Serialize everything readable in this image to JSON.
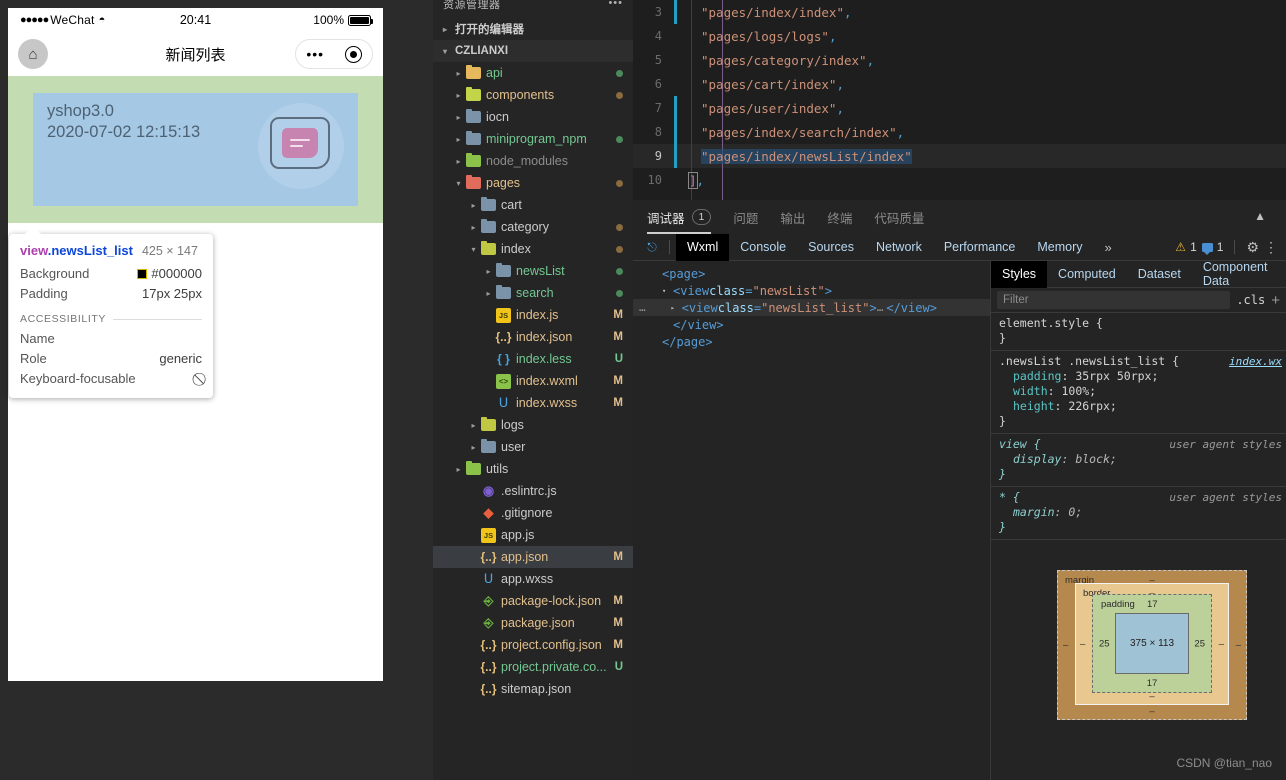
{
  "simulator": {
    "status_bar": {
      "carrier": "WeChat",
      "dots": "●●●●●",
      "wifi_icon": "wifi-icon",
      "time": "20:41",
      "battery_pct": "100%"
    },
    "nav_bar": {
      "home_icon": "home-icon",
      "title": "新闻列表",
      "menu_dots": "•••",
      "target_icon": "target-icon"
    },
    "news_item": {
      "title": "yshop3.0",
      "date": "2020-07-02 12:15:13",
      "thumb_icon": "news-thumbnail-icon"
    }
  },
  "inspect_tooltip": {
    "tag": "view",
    "class": ".newsList_list",
    "dimensions": "425 × 147",
    "rows": [
      {
        "label": "Background",
        "value": "#000000",
        "swatch": "#000000"
      },
      {
        "label": "Padding",
        "value": "17px 25px"
      }
    ],
    "a11y_header": "ACCESSIBILITY",
    "a11y_rows": [
      {
        "label": "Name",
        "value": ""
      },
      {
        "label": "Role",
        "value": "generic"
      },
      {
        "label": "Keyboard-focusable",
        "value": "⃠"
      }
    ]
  },
  "explorer": {
    "header_title": "资源管理器",
    "header_more": "•••",
    "open_editors": "打开的编辑器",
    "project_name": "CZLIANXI",
    "items": [
      {
        "name": "api",
        "type": "folder",
        "icon": "folder-yellow-icon",
        "indent": 1,
        "arrow": "▸",
        "color": "c-green",
        "dot": "d-green",
        "status": ""
      },
      {
        "name": "components",
        "type": "folder",
        "icon": "folder-ylgreen-icon",
        "indent": 1,
        "arrow": "▸",
        "color": "c-orange",
        "dot": "d-orange",
        "status": ""
      },
      {
        "name": "iocn",
        "type": "folder",
        "icon": "folder-blue-icon",
        "indent": 1,
        "arrow": "▸",
        "color": "c-white",
        "dot": "",
        "status": ""
      },
      {
        "name": "miniprogram_npm",
        "type": "folder",
        "icon": "folder-blue-icon",
        "indent": 1,
        "arrow": "▸",
        "color": "c-green",
        "dot": "d-green",
        "status": ""
      },
      {
        "name": "node_modules",
        "type": "folder",
        "icon": "folder-green-icon",
        "indent": 1,
        "arrow": "▸",
        "color": "c-gray",
        "dot": "",
        "status": ""
      },
      {
        "name": "pages",
        "type": "folder",
        "icon": "folder-red-icon",
        "indent": 1,
        "arrow": "▾",
        "color": "c-orange",
        "dot": "d-orange",
        "status": ""
      },
      {
        "name": "cart",
        "type": "folder",
        "icon": "folder-blue-icon",
        "indent": 2,
        "arrow": "▸",
        "color": "c-white",
        "dot": "",
        "status": ""
      },
      {
        "name": "category",
        "type": "folder",
        "icon": "folder-blue-icon",
        "indent": 2,
        "arrow": "▸",
        "color": "c-white",
        "dot": "d-orange",
        "status": ""
      },
      {
        "name": "index",
        "type": "folder",
        "icon": "folder-olive-icon",
        "indent": 2,
        "arrow": "▾",
        "color": "c-white",
        "dot": "d-orange",
        "status": ""
      },
      {
        "name": "newsList",
        "type": "folder",
        "icon": "folder-blue-icon",
        "indent": 3,
        "arrow": "▸",
        "color": "c-green",
        "dot": "d-green",
        "status": ""
      },
      {
        "name": "search",
        "type": "folder",
        "icon": "folder-blue-icon",
        "indent": 3,
        "arrow": "▸",
        "color": "c-green",
        "dot": "d-green",
        "status": ""
      },
      {
        "name": "index.js",
        "type": "file",
        "icon": "js-file-icon",
        "indent": 3,
        "arrow": "",
        "color": "c-orange",
        "dot": "",
        "status": "M"
      },
      {
        "name": "index.json",
        "type": "file",
        "icon": "json-file-icon",
        "indent": 3,
        "arrow": "",
        "color": "c-orange",
        "dot": "",
        "status": "M"
      },
      {
        "name": "index.less",
        "type": "file",
        "icon": "less-file-icon",
        "indent": 3,
        "arrow": "",
        "color": "c-green",
        "dot": "",
        "status": "U"
      },
      {
        "name": "index.wxml",
        "type": "file",
        "icon": "wxml-file-icon",
        "indent": 3,
        "arrow": "",
        "color": "c-orange",
        "dot": "",
        "status": "M"
      },
      {
        "name": "index.wxss",
        "type": "file",
        "icon": "wxss-file-icon",
        "indent": 3,
        "arrow": "",
        "color": "c-orange",
        "dot": "",
        "status": "M"
      },
      {
        "name": "logs",
        "type": "folder",
        "icon": "folder-olive-icon",
        "indent": 2,
        "arrow": "▸",
        "color": "c-white",
        "dot": "",
        "status": ""
      },
      {
        "name": "user",
        "type": "folder",
        "icon": "folder-blue-icon",
        "indent": 2,
        "arrow": "▸",
        "color": "c-white",
        "dot": "",
        "status": ""
      },
      {
        "name": "utils",
        "type": "folder",
        "icon": "folder-green-icon",
        "indent": 1,
        "arrow": "▸",
        "color": "c-white",
        "dot": "",
        "status": ""
      },
      {
        "name": ".eslintrc.js",
        "type": "file",
        "icon": "eslint-file-icon",
        "indent": 2,
        "arrow": "",
        "color": "c-white",
        "dot": "",
        "status": ""
      },
      {
        "name": ".gitignore",
        "type": "file",
        "icon": "git-file-icon",
        "indent": 2,
        "arrow": "",
        "color": "c-white",
        "dot": "",
        "status": ""
      },
      {
        "name": "app.js",
        "type": "file",
        "icon": "js-file-icon",
        "indent": 2,
        "arrow": "",
        "color": "c-white",
        "dot": "",
        "status": ""
      },
      {
        "name": "app.json",
        "type": "file",
        "icon": "json-file-icon",
        "indent": 2,
        "arrow": "",
        "color": "c-orange",
        "dot": "",
        "status": "M",
        "selected": true
      },
      {
        "name": "app.wxss",
        "type": "file",
        "icon": "wxss-file-icon",
        "indent": 2,
        "arrow": "",
        "color": "c-white",
        "dot": "",
        "status": ""
      },
      {
        "name": "package-lock.json",
        "type": "file",
        "icon": "npm-file-icon",
        "indent": 2,
        "arrow": "",
        "color": "c-orange",
        "dot": "",
        "status": "M"
      },
      {
        "name": "package.json",
        "type": "file",
        "icon": "npm-file-icon",
        "indent": 2,
        "arrow": "",
        "color": "c-orange",
        "dot": "",
        "status": "M"
      },
      {
        "name": "project.config.json",
        "type": "file",
        "icon": "json-file-icon",
        "indent": 2,
        "arrow": "",
        "color": "c-orange",
        "dot": "",
        "status": "M"
      },
      {
        "name": "project.private.co...",
        "type": "file",
        "icon": "json-file-icon",
        "indent": 2,
        "arrow": "",
        "color": "c-green",
        "dot": "",
        "status": "U"
      },
      {
        "name": "sitemap.json",
        "type": "file",
        "icon": "json-file-icon",
        "indent": 2,
        "arrow": "",
        "color": "c-white",
        "dot": "",
        "status": ""
      }
    ]
  },
  "editor": {
    "lines": [
      {
        "num": "3",
        "text": "\"pages/index/index\",",
        "git": true,
        "active": false
      },
      {
        "num": "4",
        "text": "\"pages/logs/logs\",",
        "git": false,
        "active": false
      },
      {
        "num": "5",
        "text": "\"pages/category/index\",",
        "git": false,
        "active": false
      },
      {
        "num": "6",
        "text": "\"pages/cart/index\",",
        "git": false,
        "active": false
      },
      {
        "num": "7",
        "text": "\"pages/user/index\",",
        "git": true,
        "active": false
      },
      {
        "num": "8",
        "text": "\"pages/index/search/index\",",
        "git": true,
        "active": false
      },
      {
        "num": "9",
        "text": "\"pages/index/newsList/index\"",
        "git": true,
        "active": true
      },
      {
        "num": "10",
        "text": "],",
        "git": false,
        "active": false
      }
    ]
  },
  "devtools": {
    "tabs": [
      {
        "label": "调试器",
        "badge": "1",
        "active": true
      },
      {
        "label": "问题",
        "badge": "",
        "active": false
      },
      {
        "label": "输出",
        "badge": "",
        "active": false
      },
      {
        "label": "终端",
        "badge": "",
        "active": false
      },
      {
        "label": "代码质量",
        "badge": "",
        "active": false
      }
    ],
    "collapse_icon": "chevron-up-icon",
    "panel_tabs": [
      {
        "label": "Wxml",
        "active": true
      },
      {
        "label": "Console",
        "active": false
      },
      {
        "label": "Sources",
        "active": false
      },
      {
        "label": "Network",
        "active": false
      },
      {
        "label": "Performance",
        "active": false
      },
      {
        "label": "Memory",
        "active": false
      }
    ],
    "more_tabs_icon": "»",
    "warning_count": "1",
    "message_count": "1",
    "gear_icon": "gear-icon",
    "kebab_icon": "kebab-menu-icon",
    "wxml_tree": [
      {
        "indent": 0,
        "tri": "",
        "html": "<span class=\"tagc\">&lt;page&gt;</span>",
        "sel": false,
        "ellipsis": false
      },
      {
        "indent": 1,
        "tri": "▾",
        "html": "<span class=\"tagc\">&lt;view </span><span class=\"attr-n\">class</span><span class=\"tagc\">=</span><span class=\"attr-v\">\"newsList\"</span><span class=\"tagc\">&gt;</span>",
        "sel": false,
        "ellipsis": false
      },
      {
        "indent": 2,
        "tri": "▸",
        "html": "<span class=\"tagc\">&lt;view </span><span class=\"attr-n\">class</span><span class=\"tagc\">=</span><span class=\"attr-v\">\"newsList_list\"</span><span class=\"tagc\">&gt;</span><span class=\"ellip\">…</span><span class=\"tagc\">&lt;/view&gt;</span>",
        "sel": true,
        "ellipsis": true
      },
      {
        "indent": 1,
        "tri": "",
        "html": "<span class=\"tagc\">&lt;/view&gt;</span>",
        "sel": false,
        "ellipsis": false
      },
      {
        "indent": 0,
        "tri": "",
        "html": "<span class=\"tagc\">&lt;/page&gt;</span>",
        "sel": false,
        "ellipsis": false
      }
    ],
    "styles": {
      "tabs": [
        {
          "label": "Styles",
          "active": true
        },
        {
          "label": "Computed",
          "active": false
        },
        {
          "label": "Dataset",
          "active": false
        },
        {
          "label": "Component Data",
          "active": false
        }
      ],
      "filter_placeholder": "Filter",
      "cls_label": ".cls",
      "plus_label": "+",
      "rules": [
        {
          "selector": "element.style {",
          "source": "",
          "declarations": [],
          "close": "}",
          "italic": false
        },
        {
          "selector": ".newsList .newsList_list {",
          "source": "index.wx",
          "source_link": true,
          "declarations": [
            {
              "prop": "padding",
              "value": "35rpx 50rpx;"
            },
            {
              "prop": "width",
              "value": "100%;"
            },
            {
              "prop": "height",
              "value": "226rpx;"
            }
          ],
          "close": "}",
          "italic": false
        },
        {
          "selector": "view {",
          "source": "user agent styles",
          "source_link": false,
          "declarations": [
            {
              "prop": "display",
              "value": "block;"
            }
          ],
          "close": "}",
          "italic": true
        },
        {
          "selector": "* {",
          "source": "user agent styles",
          "source_link": false,
          "declarations": [
            {
              "prop": "margin",
              "value": "0;"
            }
          ],
          "close": "}",
          "italic": true
        }
      ],
      "box_model": {
        "margin_label": "margin",
        "border_label": "border",
        "padding_label": "padding",
        "content": "375 × 113",
        "margin_top": "–",
        "margin_right": "–",
        "margin_bottom": "–",
        "margin_left": "–",
        "border_top": "–",
        "border_right": "–",
        "border_bottom": "–",
        "border_left": "–",
        "padding_top": "17",
        "padding_right": "25",
        "padding_bottom": "17",
        "padding_left": "25"
      }
    }
  },
  "watermark": "CSDN @tian_nao"
}
